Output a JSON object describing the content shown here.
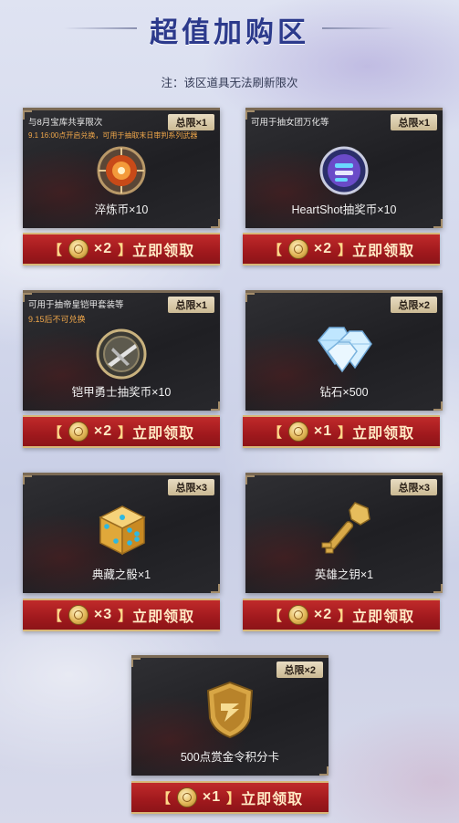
{
  "header": {
    "title": "超值加购区",
    "notice": "注：该区道具无法刷新限次"
  },
  "items": [
    {
      "tag": "与8月宝库共享限次",
      "sub": "9.1 16:00点开启兑换，可用于抽取末日审判系列武器",
      "limit": "总限×1",
      "name": "淬炼币×10",
      "icon": "refining-coin-icon",
      "btn": {
        "open": "【",
        "close": "】",
        "qty": "×2",
        "action": "立即领取"
      }
    },
    {
      "tag": "可用于抽女团万化等",
      "sub": "",
      "limit": "总限×1",
      "name": "HeartShot抽奖币×10",
      "icon": "heartshot-coin-icon",
      "btn": {
        "open": "【",
        "close": "】",
        "qty": "×2",
        "action": "立即领取"
      }
    },
    {
      "tag": "可用于抽帝皇铠甲套装等",
      "sub": "9.15后不可兑换",
      "limit": "总限×1",
      "name": "铠甲勇士抽奖币×10",
      "icon": "armor-coin-icon",
      "btn": {
        "open": "【",
        "close": "】",
        "qty": "×2",
        "action": "立即领取"
      }
    },
    {
      "tag": "",
      "sub": "",
      "limit": "总限×2",
      "name": "钻石×500",
      "icon": "diamond-icon",
      "btn": {
        "open": "【",
        "close": "】",
        "qty": "×1",
        "action": "立即领取"
      }
    },
    {
      "tag": "",
      "sub": "",
      "limit": "总限×3",
      "name": "典藏之骰×1",
      "icon": "dice-icon",
      "btn": {
        "open": "【",
        "close": "】",
        "qty": "×3",
        "action": "立即领取"
      }
    },
    {
      "tag": "",
      "sub": "",
      "limit": "总限×3",
      "name": "英雄之钥×1",
      "icon": "key-icon",
      "btn": {
        "open": "【",
        "close": "】",
        "qty": "×2",
        "action": "立即领取"
      }
    },
    {
      "tag": "",
      "sub": "",
      "limit": "总限×2",
      "name": "500点赏金令积分卡",
      "icon": "bounty-card-icon",
      "btn": {
        "open": "【",
        "close": "】",
        "qty": "×1",
        "action": "立即领取"
      }
    }
  ],
  "colors": {
    "title": "#2c3a8c",
    "button": "#a0191d",
    "sub_text": "#f0a74a"
  }
}
